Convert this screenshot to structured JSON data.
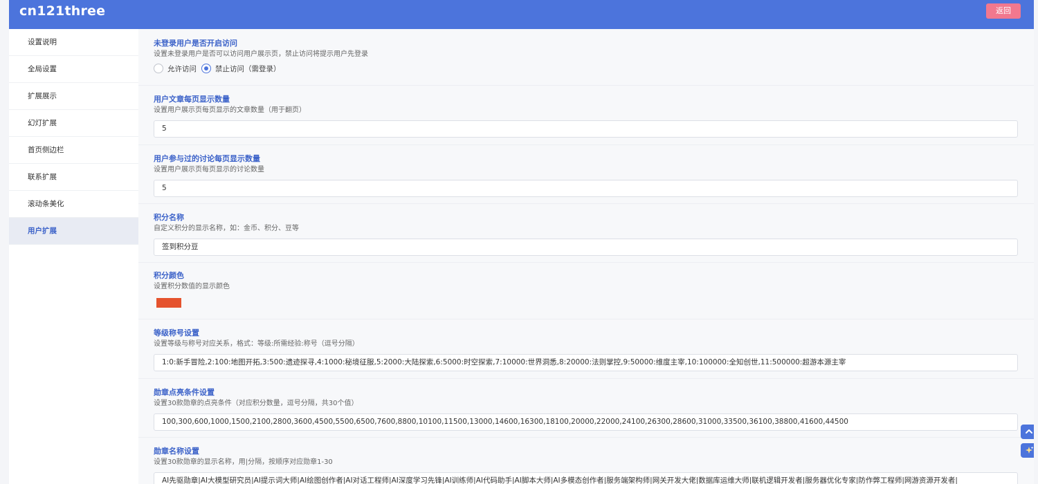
{
  "app": {
    "title": "cn121three",
    "back_label": "返回"
  },
  "colors": {
    "header": "#4c74dc",
    "back_button": "#f2788e",
    "accent": "#3d63c9",
    "points_color": "#e5532e"
  },
  "sidebar": {
    "items": [
      {
        "label": "设置说明"
      },
      {
        "label": "全局设置"
      },
      {
        "label": "扩展展示"
      },
      {
        "label": "幻灯扩展"
      },
      {
        "label": "首页侧边栏"
      },
      {
        "label": "联系扩展"
      },
      {
        "label": "滚动条美化"
      },
      {
        "label": "用户扩展"
      }
    ],
    "active_label": "用户扩展"
  },
  "settings": {
    "guest_access": {
      "title": "未登录用户是否开启访问",
      "desc": "设置未登录用户是否可以访问用户展示页，禁止访问将提示用户先登录",
      "options": [
        {
          "label": "允许访问",
          "checked": false
        },
        {
          "label": "禁止访问（需登录）",
          "checked": true
        }
      ]
    },
    "posts_per_page": {
      "title": "用户文章每页显示数量",
      "desc": "设置用户展示页每页显示的文章数量（用于翻页）",
      "value": "5"
    },
    "discussions_per_page": {
      "title": "用户参与过的讨论每页显示数量",
      "desc": "设置用户展示页每页显示的讨论数量",
      "value": "5"
    },
    "points_name": {
      "title": "积分名称",
      "desc": "自定义积分的显示名称，如：金币、积分、豆等",
      "value": "签到积分豆"
    },
    "points_color": {
      "title": "积分颜色",
      "desc": "设置积分数值的显示颜色",
      "value": "#e5532e"
    },
    "level_titles": {
      "title": "等级称号设置",
      "desc": "设置等级与称号对应关系，格式：等级:所需经验:称号（逗号分隔）",
      "value": "1:0:新手冒险,2:100:地图开拓,3:500:遗迹探寻,4:1000:秘境征服,5:2000:大陆探索,6:5000:时空探索,7:10000:世界洞悉,8:20000:法则掌控,9:50000:维度主宰,10:100000:全知创世,11:500000:超游本源主宰"
    },
    "badge_conditions": {
      "title": "勋章点亮条件设置",
      "desc": "设置30款勋章的点亮条件（对应积分数量，逗号分隔，共30个值）",
      "value": "100,300,600,1000,1500,2100,2800,3600,4500,5500,6500,7600,8800,10100,11500,13000,14600,16300,18100,20000,22000,24100,26300,28600,31000,33500,36100,38800,41600,44500"
    },
    "badge_names": {
      "title": "勋章名称设置",
      "desc": "设置30款勋章的显示名称，用|分隔，按顺序对应勋章1-30",
      "value": "AI先驱勋章|AI大模型研究员|AI提示词大师|AI绘图创作者|AI对话工程师|AI深度学习先锋|AI训练师|AI代码助手|AI脚本大师|AI多模态创作者|服务端架构师|网关开发大佬|数据库运维大师|联机逻辑开发者|服务器优化专家|防作弊工程师|网游资源开发者|"
    }
  },
  "float_buttons": [
    {
      "icon": "chevron-up-icon"
    },
    {
      "icon": "sparkle-icon"
    }
  ]
}
